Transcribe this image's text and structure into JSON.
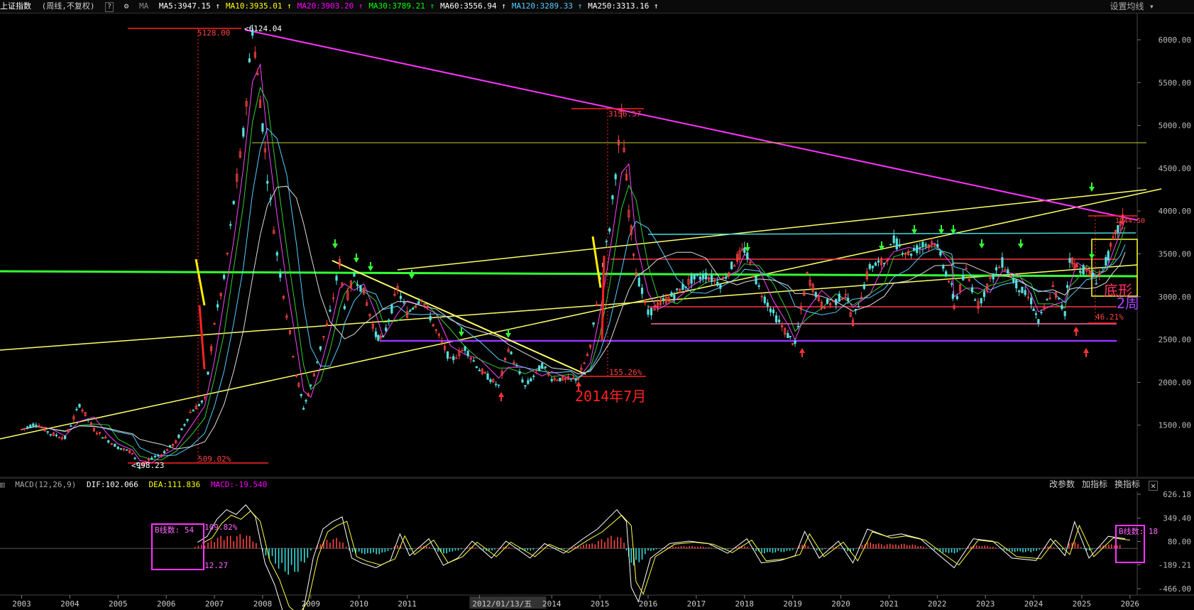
{
  "header": {
    "title": "上证指数",
    "mode": "(周线,不复权)",
    "help": "?",
    "ma_label": "MA",
    "ma": [
      {
        "label": "MA5:3947.15",
        "color": "#ffffff"
      },
      {
        "label": "MA10:3935.01",
        "color": "#ffff00"
      },
      {
        "label": "MA20:3903.20",
        "color": "#ff00ff"
      },
      {
        "label": "MA30:3789.21",
        "color": "#00ff00"
      },
      {
        "label": "MA60:3556.94",
        "color": "#ffffff"
      },
      {
        "label": "MA120:3289.33",
        "color": "#55ccff"
      },
      {
        "label": "MA250:3313.16",
        "color": "#ffffff"
      }
    ],
    "settings": "设置均线"
  },
  "macd_header": {
    "title": "MACD(12,26,9)",
    "dif": "DIF:102.066",
    "dea": "DEA:111.836",
    "macd": "MACD:-19.540",
    "tools": [
      "改参数",
      "加指标",
      "换指标"
    ]
  },
  "chart_data": {
    "type": "candlestick",
    "price_axis": {
      "ticks": [
        "6000.00",
        "5500.00",
        "5000.00",
        "4500.00",
        "4000.00",
        "3500.00",
        "3000.00",
        "2500.00",
        "2000.00",
        "1500.00"
      ]
    },
    "macd_axis": {
      "ticks": [
        "626.18",
        "349.40",
        "80.00",
        "-189.21",
        "-466.00"
      ]
    },
    "x_ticks": [
      "2003",
      "2004",
      "2005",
      "2006",
      "2007",
      "2008",
      "2009",
      "2010",
      "2011",
      "2012/01/13/五",
      "2014",
      "2015",
      "2016",
      "2017",
      "2018",
      "2019",
      "2020",
      "2021",
      "2022",
      "2023",
      "2024",
      "2025",
      "2026"
    ],
    "annotations": {
      "high_2007": "6124.04",
      "ref_2007": "5128.00",
      "low_2005": "998.23",
      "pct_2005": "509.02%",
      "high_2015": "3156.57",
      "pct_2014": "155.26%",
      "label_2014": "2014年7月",
      "pct_2024": "46.21%",
      "ref_2025": "1244.50",
      "box_left": "B线数: 54",
      "box_left_pct": "109.82%",
      "box_left_val": "12.27",
      "box_right": "B线数: 18",
      "right_text_1": "2周",
      "right_text_2": "底形"
    },
    "series_close": [
      [
        2003.0,
        1450
      ],
      [
        2003.3,
        1520
      ],
      [
        2003.6,
        1400
      ],
      [
        2003.9,
        1350
      ],
      [
        2004.2,
        1740
      ],
      [
        2004.5,
        1450
      ],
      [
        2004.8,
        1320
      ],
      [
        2005.0,
        1240
      ],
      [
        2005.3,
        1180
      ],
      [
        2005.45,
        998
      ],
      [
        2005.7,
        1120
      ],
      [
        2005.9,
        1160
      ],
      [
        2006.2,
        1300
      ],
      [
        2006.5,
        1650
      ],
      [
        2006.8,
        1800
      ],
      [
        2007.0,
        2700
      ],
      [
        2007.2,
        3200
      ],
      [
        2007.4,
        4100
      ],
      [
        2007.6,
        4900
      ],
      [
        2007.79,
        6124
      ],
      [
        2007.95,
        5300
      ],
      [
        2008.1,
        4400
      ],
      [
        2008.3,
        3500
      ],
      [
        2008.5,
        2800
      ],
      [
        2008.7,
        2100
      ],
      [
        2008.85,
        1700
      ],
      [
        2009.0,
        1950
      ],
      [
        2009.2,
        2400
      ],
      [
        2009.4,
        2800
      ],
      [
        2009.6,
        3400
      ],
      [
        2009.7,
        2900
      ],
      [
        2009.9,
        3250
      ],
      [
        2010.1,
        3050
      ],
      [
        2010.35,
        2550
      ],
      [
        2010.5,
        2500
      ],
      [
        2010.8,
        3100
      ],
      [
        2011.0,
        2800
      ],
      [
        2011.3,
        3000
      ],
      [
        2011.6,
        2600
      ],
      [
        2011.9,
        2250
      ],
      [
        2012.2,
        2400
      ],
      [
        2012.5,
        2150
      ],
      [
        2012.9,
        1950
      ],
      [
        2013.1,
        2400
      ],
      [
        2013.45,
        1950
      ],
      [
        2013.8,
        2200
      ],
      [
        2014.0,
        2050
      ],
      [
        2014.4,
        2030
      ],
      [
        2014.55,
        2050
      ],
      [
        2014.8,
        2400
      ],
      [
        2015.0,
        3200
      ],
      [
        2015.2,
        3800
      ],
      [
        2015.45,
        5100
      ],
      [
        2015.6,
        4000
      ],
      [
        2015.75,
        3300
      ],
      [
        2016.0,
        2800
      ],
      [
        2016.2,
        2900
      ],
      [
        2016.6,
        3050
      ],
      [
        2016.9,
        3200
      ],
      [
        2017.2,
        3250
      ],
      [
        2017.5,
        3150
      ],
      [
        2017.85,
        3450
      ],
      [
        2018.0,
        3550
      ],
      [
        2018.3,
        3100
      ],
      [
        2018.6,
        2800
      ],
      [
        2018.9,
        2550
      ],
      [
        2019.05,
        2440
      ],
      [
        2019.3,
        3250
      ],
      [
        2019.6,
        2900
      ],
      [
        2019.9,
        2950
      ],
      [
        2020.1,
        3050
      ],
      [
        2020.25,
        2700
      ],
      [
        2020.6,
        3350
      ],
      [
        2020.9,
        3400
      ],
      [
        2021.1,
        3650
      ],
      [
        2021.4,
        3500
      ],
      [
        2021.7,
        3600
      ],
      [
        2021.95,
        3650
      ],
      [
        2022.3,
        3100
      ],
      [
        2022.35,
        2900
      ],
      [
        2022.6,
        3300
      ],
      [
        2022.85,
        2900
      ],
      [
        2023.1,
        3200
      ],
      [
        2023.35,
        3400
      ],
      [
        2023.7,
        3100
      ],
      [
        2023.95,
        2950
      ],
      [
        2024.1,
        2700
      ],
      [
        2024.4,
        3100
      ],
      [
        2024.65,
        2800
      ],
      [
        2024.75,
        3450
      ],
      [
        2024.9,
        3350
      ],
      [
        2025.1,
        3300
      ],
      [
        2025.3,
        3200
      ],
      [
        2025.5,
        3400
      ],
      [
        2025.65,
        3650
      ],
      [
        2025.8,
        3850
      ],
      [
        2025.9,
        3950
      ]
    ],
    "macd_hist": [
      [
        2006.6,
        25
      ],
      [
        2006.8,
        50
      ],
      [
        2007.0,
        120
      ],
      [
        2007.2,
        160
      ],
      [
        2007.4,
        140
      ],
      [
        2007.6,
        180
      ],
      [
        2007.8,
        130
      ],
      [
        2008.0,
        -60
      ],
      [
        2008.2,
        -150
      ],
      [
        2008.4,
        -280
      ],
      [
        2008.6,
        -320
      ],
      [
        2008.8,
        -250
      ],
      [
        2009.0,
        -40
      ],
      [
        2009.2,
        80
      ],
      [
        2009.4,
        110
      ],
      [
        2009.6,
        130
      ],
      [
        2009.8,
        -40
      ],
      [
        2010.0,
        -60
      ],
      [
        2010.3,
        -80
      ],
      [
        2010.6,
        -50
      ],
      [
        2010.8,
        60
      ],
      [
        2011.0,
        -30
      ],
      [
        2011.4,
        40
      ],
      [
        2011.7,
        -70
      ],
      [
        2012.0,
        -40
      ],
      [
        2012.3,
        30
      ],
      [
        2012.7,
        -40
      ],
      [
        2013.0,
        30
      ],
      [
        2013.5,
        -40
      ],
      [
        2013.8,
        20
      ],
      [
        2014.2,
        -20
      ],
      [
        2014.6,
        40
      ],
      [
        2014.9,
        80
      ],
      [
        2015.1,
        120
      ],
      [
        2015.3,
        160
      ],
      [
        2015.5,
        110
      ],
      [
        2015.6,
        -160
      ],
      [
        2015.75,
        -220
      ],
      [
        2016.0,
        -40
      ],
      [
        2016.4,
        20
      ],
      [
        2016.8,
        30
      ],
      [
        2017.2,
        20
      ],
      [
        2017.6,
        -20
      ],
      [
        2018.0,
        40
      ],
      [
        2018.3,
        -60
      ],
      [
        2018.7,
        -50
      ],
      [
        2019.0,
        -30
      ],
      [
        2019.2,
        70
      ],
      [
        2019.5,
        -40
      ],
      [
        2019.9,
        30
      ],
      [
        2020.2,
        -60
      ],
      [
        2020.5,
        80
      ],
      [
        2020.9,
        50
      ],
      [
        2021.2,
        60
      ],
      [
        2021.6,
        40
      ],
      [
        2022.0,
        -30
      ],
      [
        2022.3,
        -80
      ],
      [
        2022.7,
        40
      ],
      [
        2023.1,
        30
      ],
      [
        2023.5,
        -40
      ],
      [
        2024.0,
        -50
      ],
      [
        2024.3,
        40
      ],
      [
        2024.6,
        -30
      ],
      [
        2024.8,
        110
      ],
      [
        2025.1,
        -40
      ],
      [
        2025.5,
        50
      ],
      [
        2025.85,
        40
      ]
    ]
  }
}
